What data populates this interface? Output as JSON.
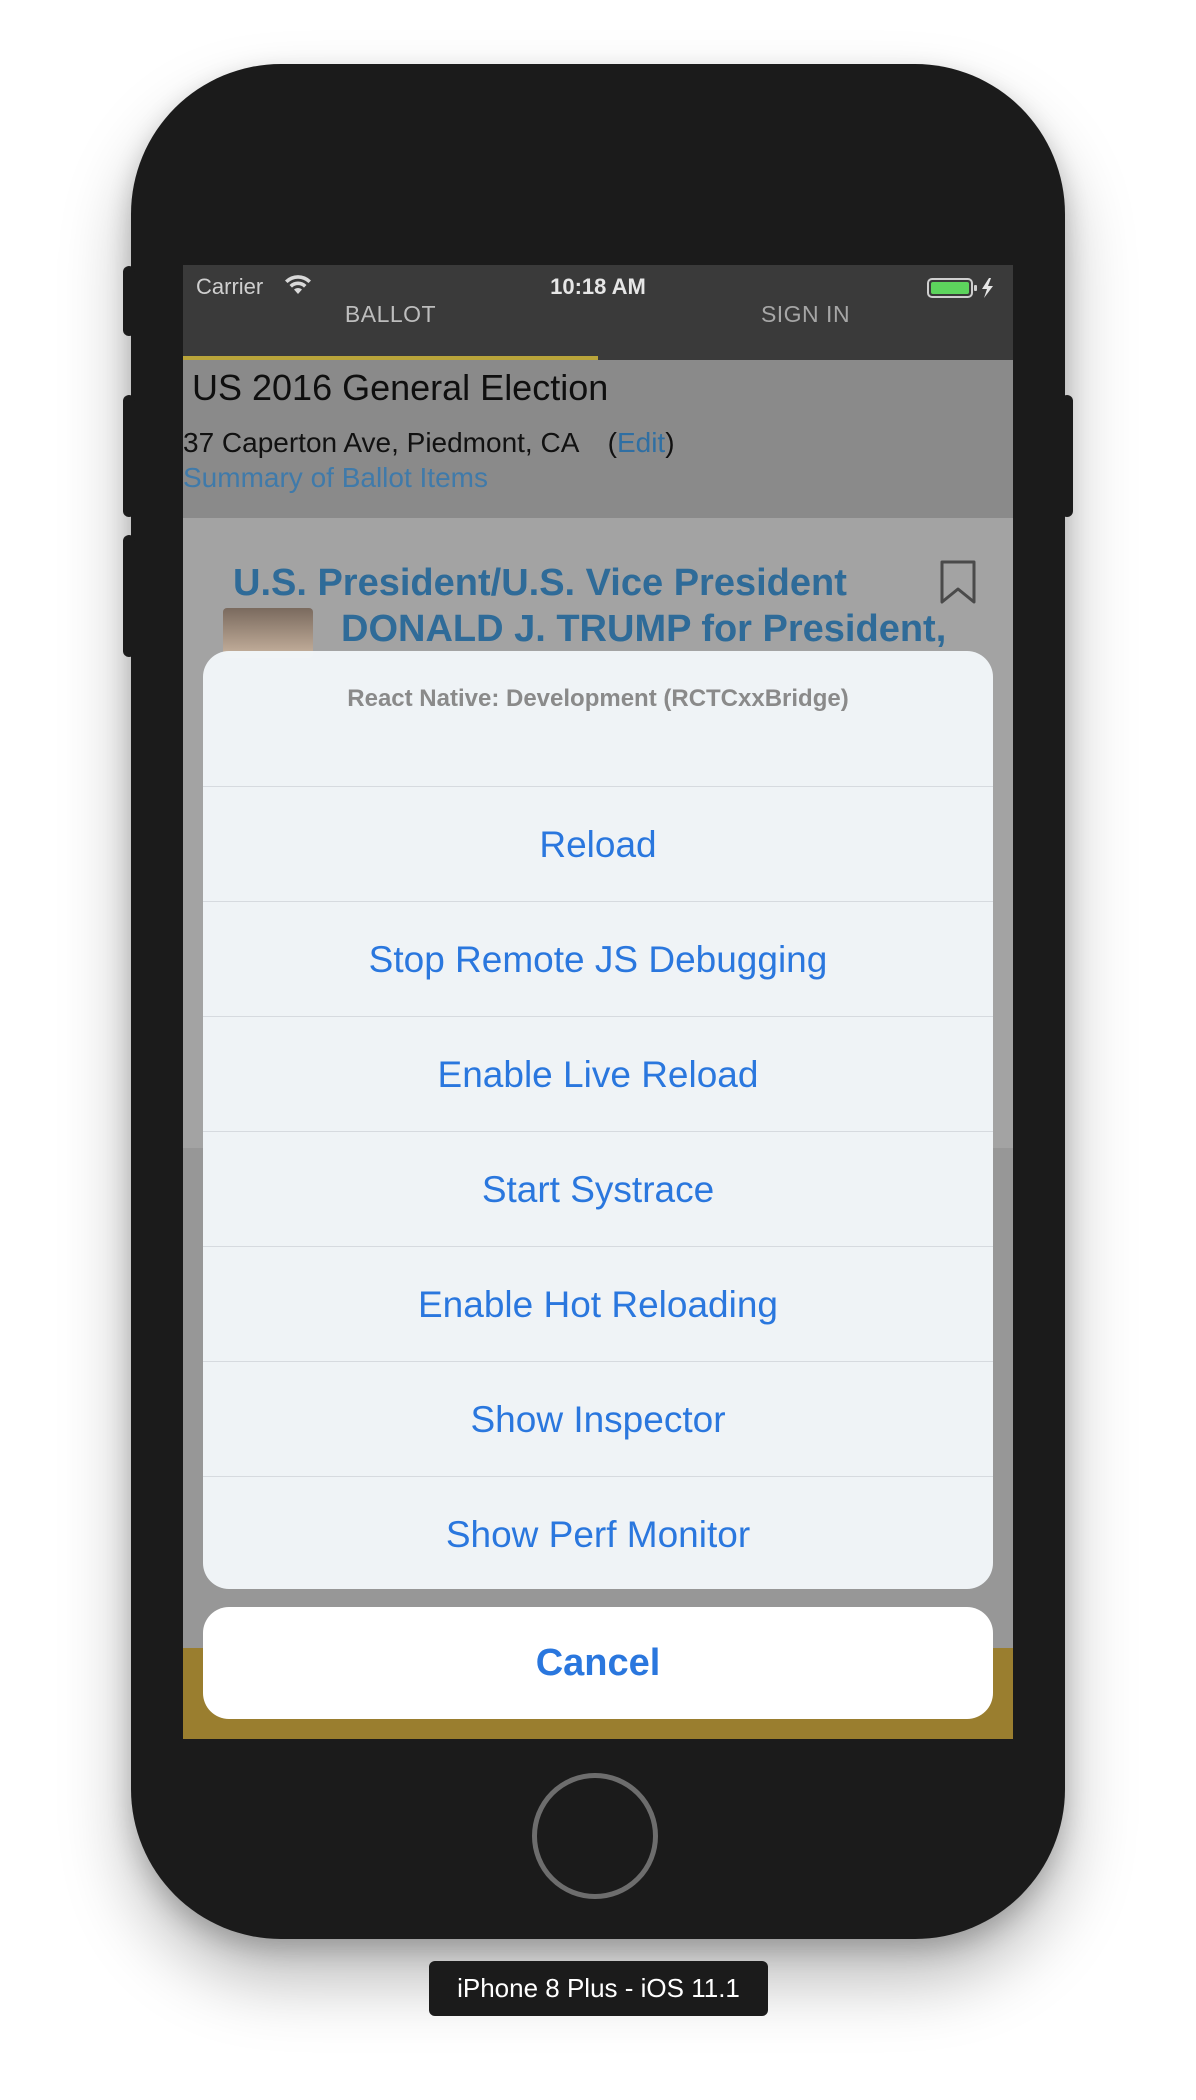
{
  "status_bar": {
    "carrier": "Carrier",
    "time": "10:18 AM",
    "icons": [
      "wifi-icon",
      "battery-icon",
      "charging-bolt-icon"
    ]
  },
  "nav": {
    "tabs": [
      {
        "label": "BALLOT",
        "selected": true
      },
      {
        "label": "SIGN IN",
        "selected": false
      }
    ],
    "accent_color": "#b9a43a"
  },
  "ballot": {
    "election_title": "US 2016 General Election",
    "address": "37 Caperton Ave, Piedmont, CA",
    "edit_open": "(",
    "edit_label": "Edit",
    "edit_close": ")",
    "summary_link": "Summary of Ballot Items",
    "office_title": "U.S. President/U.S. Vice President",
    "candidate_name": "DONALD J. TRUMP for President,",
    "bookmark_icon": "bookmark-icon"
  },
  "action_sheet": {
    "title": "React Native: Development (RCTCxxBridge)",
    "items": [
      "Reload",
      "Stop Remote JS Debugging",
      "Enable Live Reload",
      "Start Systrace",
      "Enable Hot Reloading",
      "Show Inspector",
      "Show Perf Monitor"
    ],
    "cancel_label": "Cancel",
    "action_color": "#2a77de"
  },
  "device": {
    "label": "iPhone 8 Plus - iOS 11.1"
  }
}
